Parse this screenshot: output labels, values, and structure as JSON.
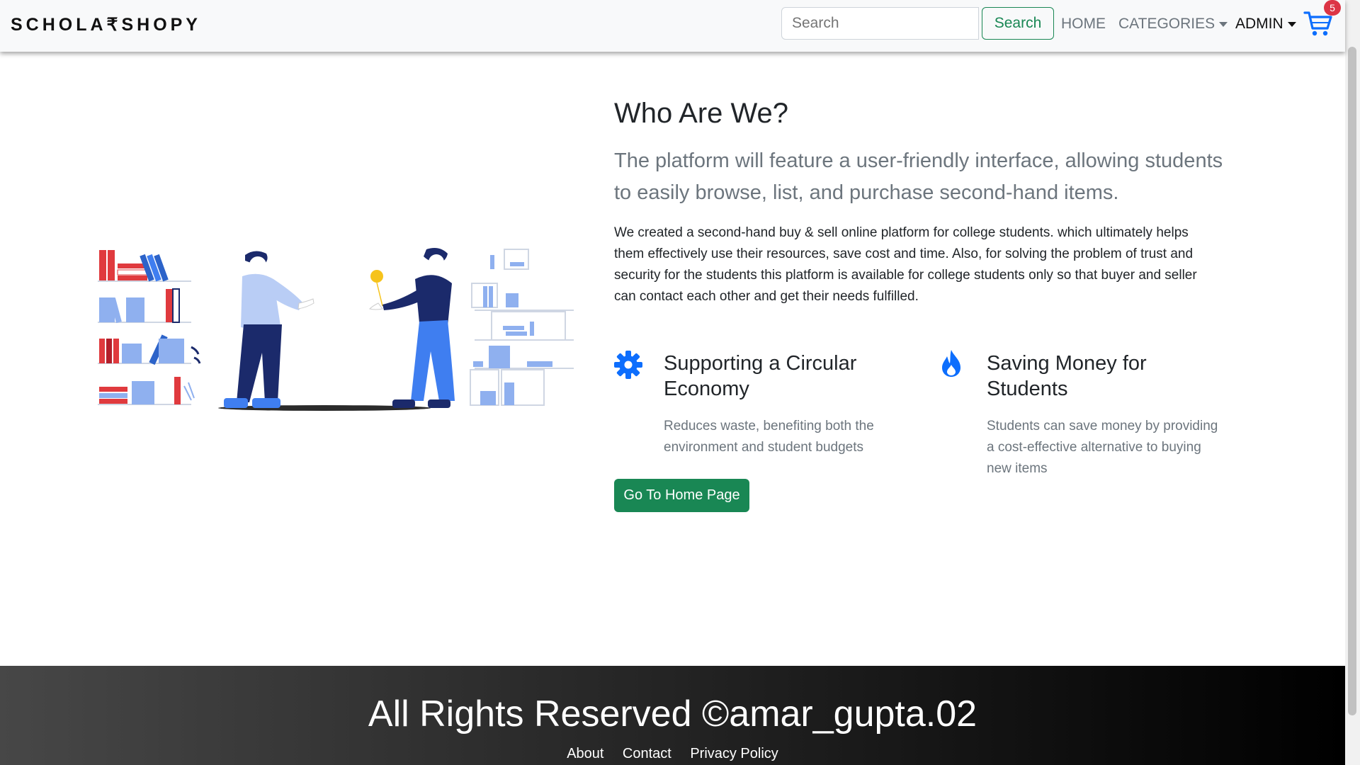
{
  "navbar": {
    "brand": "SCHOLA₹SHOPY",
    "search_placeholder": "Search",
    "search_button": "Search",
    "links": {
      "home": "HOME",
      "categories": "CATEGORIES",
      "admin": "ADMIN"
    },
    "cart_count": "5"
  },
  "main": {
    "title": "Who Are We?",
    "lead": "The platform will feature a user-friendly interface, allowing students to easily browse, list, and purchase second-hand items.",
    "body": "We created a second-hand buy & sell online platform for college students. which ultimately helps them effectively use their resources, save cost and time. Also, for solving the problem of trust and security for the students this platform is available for college students only so that buyer and seller can contact each other and get their needs fulfilled.",
    "features": [
      {
        "icon": "gear-icon",
        "title": "Supporting a Circular Economy",
        "text": "Reduces waste, benefiting both the environment and student budgets"
      },
      {
        "icon": "fire-icon",
        "title": "Saving Money for Students",
        "text": "Students can save money by providing a cost-effective alternative to buying new items"
      }
    ],
    "button": "Go To Home Page"
  },
  "footer": {
    "title": "All Rights Reserved ©amar_gupta.02",
    "links": [
      "About",
      "Contact",
      "Privacy Policy"
    ]
  },
  "colors": {
    "accent": "#198754",
    "primary_blue": "#0d6efd",
    "badge_red": "#dc3545"
  }
}
